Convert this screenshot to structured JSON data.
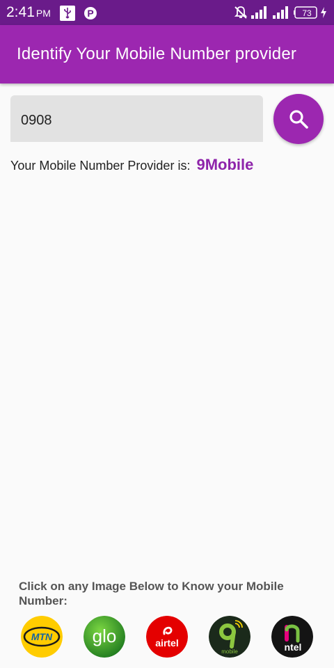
{
  "status_bar": {
    "time": "2:41",
    "ampm": "PM",
    "battery": "73",
    "icons": [
      "usb-icon",
      "parking-app-icon",
      "notifications-off-icon",
      "signal-icon",
      "signal-icon",
      "battery-icon",
      "charging-icon"
    ]
  },
  "app_bar": {
    "title": "Identify Your Mobile Number provider"
  },
  "search": {
    "value": "0908",
    "button_icon": "search-icon"
  },
  "result": {
    "label": "Your Mobile Number Provider is:",
    "value": "9Mobile"
  },
  "footer": {
    "label": "Click on any Image Below to Know your Mobile Number:",
    "logos": [
      {
        "label": "MTN"
      },
      {
        "label": "glo"
      },
      {
        "label": "airtel"
      },
      {
        "label": "mobile"
      },
      {
        "label": "ntel"
      }
    ]
  },
  "colors": {
    "primary": "#9c27b0",
    "status_bar": "#6a1b8a",
    "accent_text": "#8e24aa",
    "field_bg": "#e2e2e2"
  }
}
